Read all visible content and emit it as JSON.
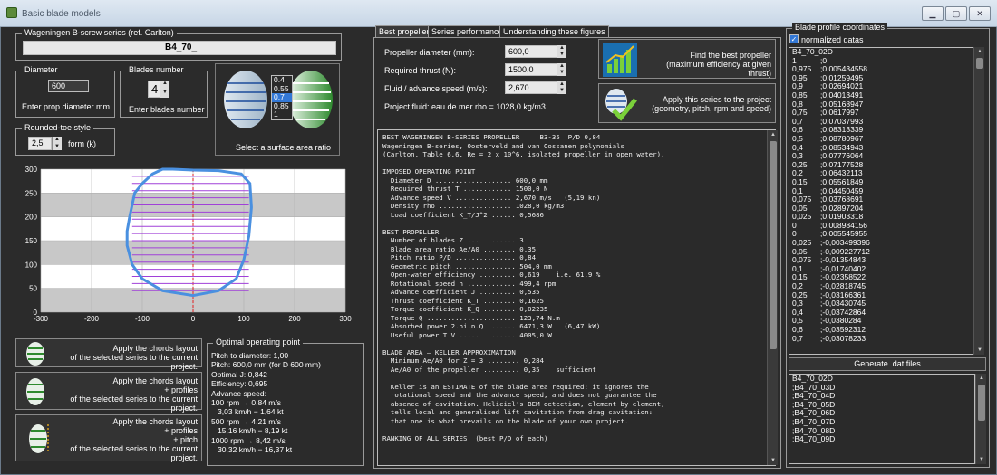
{
  "window": {
    "title": "Basic blade models",
    "controls": [
      "min",
      "max",
      "close"
    ]
  },
  "series": {
    "group_title": "Wageningen B-screw series (ref. Carlton)",
    "name": "B4_70_"
  },
  "diameter": {
    "group_title": "Diameter",
    "value": "600",
    "caption": "Enter prop diameter mm"
  },
  "blades": {
    "group_title": "Blades number",
    "value": "4",
    "caption": "Enter blades number"
  },
  "area_ratio": {
    "options": [
      "0.4",
      "0.55",
      "0.7",
      "0.85",
      "1"
    ],
    "selected": "0.7",
    "caption": "Select a surface area ratio"
  },
  "rounded_toe": {
    "group_title": "Rounded-toe style",
    "value": "2,5",
    "caption": "form (k)"
  },
  "plot": {
    "x_ticks": [
      "-300",
      "-200",
      "-100",
      "0",
      "100",
      "200",
      "300"
    ],
    "y_ticks": [
      "300",
      "250",
      "200",
      "150",
      "100",
      "50",
      "0"
    ]
  },
  "chart_data": {
    "type": "line",
    "title": "",
    "xlabel": "",
    "ylabel": "",
    "xlim": [
      -300,
      300
    ],
    "ylim": [
      0,
      300
    ],
    "grid": true,
    "series": [
      {
        "outline": true,
        "x": [
          -60,
          -80,
          -100,
          -115,
          -120,
          -125,
          -130,
          -130,
          -120,
          -100,
          -60,
          0,
          50,
          85,
          100,
          110,
          115,
          112,
          95,
          50,
          0,
          -40
        ],
        "y": [
          300,
          290,
          270,
          250,
          225,
          200,
          170,
          140,
          100,
          70,
          45,
          35,
          45,
          70,
          110,
          160,
          220,
          270,
          290,
          297,
          298,
          300
        ]
      }
    ]
  },
  "apply_buttons": [
    {
      "text": "Apply the chords layout\nof the selected series to the current project."
    },
    {
      "text": "Apply the chords layout\n+ profiles\nof the selected series to the current project."
    },
    {
      "text": "Apply the chords layout\n+ profiles\n+ pitch\nof the selected series to the current project."
    }
  ],
  "optimal": {
    "group_title": "Optimal operating point",
    "lines": [
      "Pitch to diameter: 1,00",
      "Pitch: 600,0 mm (for D 600 mm)",
      "Optimal J: 0,842",
      "Efficiency: 0,695",
      "Advance speed:",
      "100 rpm → 0,84 m/s",
      "   3,03 km/h − 1,64 kt",
      "500 rpm → 4,21 m/s",
      "   15,16 km/h − 8,19 kt",
      "1000 rpm → 8,42 m/s",
      "   30,32 km/h − 16,37 kt"
    ]
  },
  "tabs": [
    "Best propeller",
    "Series performance",
    "Understanding these figures"
  ],
  "inputs": {
    "diameter_label": "Propeller diameter (mm):",
    "diameter_value": "600,0",
    "thrust_label": "Required thrust (N):",
    "thrust_value": "1500,0",
    "speed_label": "Fluid / advance speed (m/s):",
    "speed_value": "2,670",
    "fluid_text": "Project fluid: eau de mer   rho = 1028,0 kg/m3"
  },
  "actions": {
    "find_best": "Find the best propeller\n(maximum efficiency at given thrust)",
    "apply_series": "Apply this series to the project\n(geometry, pitch, rpm and speed)"
  },
  "report_text": "BEST WAGENINGEN B-SERIES PROPELLER  —  B3-35  P/D 0,84\nWageningen B-series, Oosterveld and van Oossanen polynomials\n(Carlton, Table 6.6, Re = 2 x 10^6, isolated propeller in open water).\n\nIMPOSED OPERATING POINT\n  Diameter D ................... 600,0 mm\n  Required thrust T ............ 1500,0 N\n  Advance speed V .............. 2,670 m/s   (5,19 kn)\n  Density rho .................. 1028,0 kg/m3\n  Load coefficient K_T/J^2 ...... 0,5686\n\nBEST PROPELLER\n  Number of blades Z ............ 3\n  Blade area ratio Ae/A0 ........ 0,35\n  Pitch ratio P/D ............... 0,84\n  Geometric pitch ............... 504,0 mm\n  Open-water efficiency ......... 0,619    i.e. 61,9 %\n  Rotational speed n ............ 499,4 rpm\n  Advance coefficient J ......... 0,535\n  Thrust coefficient K_T ........ 0,1625\n  Torque coefficient K_Q ........ 0,02235\n  Torque Q ...................... 123,74 N.m\n  Absorbed power 2.pi.n.Q ....... 6471,3 W   (6,47 kW)\n  Useful power T.V .............. 4005,0 W\n\nBLADE AREA — KELLER APPROXIMATION\n  Minimum Ae/A0 for Z = 3 ........ 0,284\n  Ae/A0 of the propeller ......... 0,35    sufficient\n\n  Keller is an ESTIMATE of the blade area required: it ignores the\n  rotational speed and the advance speed, and does not guarantee the\n  absence of cavitation. Heliciel's BEM detection, element by element,\n  tells local and generalised lift cavitation from drag cavitation:\n  that one is what prevails on the blade of your own project.\n\nRANKING OF ALL SERIES  (best P/D of each)",
  "profile": {
    "group_title": "Blade profile coordinates",
    "checkbox_label": "normalized datas",
    "checked": true,
    "header": "B4_70_02D",
    "rows": [
      [
        "1",
        ";0"
      ],
      [
        "0,975",
        ";0,005434558"
      ],
      [
        "0,95",
        ";0,01259495"
      ],
      [
        "0,9",
        ";0,02694021"
      ],
      [
        "0,85",
        ";0,04013491"
      ],
      [
        "0,8",
        ";0,05168947"
      ],
      [
        "0,75",
        ";0,0617997"
      ],
      [
        "0,7",
        ";0,07037993"
      ],
      [
        "0,6",
        ";0,08313339"
      ],
      [
        "0,5",
        ";0,08780967"
      ],
      [
        "0,4",
        ";0,08534943"
      ],
      [
        "0,3",
        ";0,07776064"
      ],
      [
        "0,25",
        ";0,07177528"
      ],
      [
        "0,2",
        ";0,06432113"
      ],
      [
        "0,15",
        ";0,05561849"
      ],
      [
        "0,1",
        ";0,04450459"
      ],
      [
        "0,075",
        ";0,03768691"
      ],
      [
        "0,05",
        ";0,02897204"
      ],
      [
        "0,025",
        ";0,01903318"
      ],
      [
        "0",
        ";0,008984156"
      ],
      [
        "0",
        ";0,005545955"
      ],
      [
        "0,025",
        ";-0,003499396"
      ],
      [
        "0,05",
        ";-0,009227712"
      ],
      [
        "0,075",
        ";-0,01354843"
      ],
      [
        "0,1",
        ";-0,01740402"
      ],
      [
        "0,15",
        ";-0,02358522"
      ],
      [
        "0,2",
        ";-0,02818745"
      ],
      [
        "0,25",
        ";-0,03166361"
      ],
      [
        "0,3",
        ";-0,03430745"
      ],
      [
        "0,4",
        ";-0,03742864"
      ],
      [
        "0,5",
        ";-0,0380284"
      ],
      [
        "0,6",
        ";-0,03592312"
      ],
      [
        "0,7",
        ";-0,03078233"
      ]
    ],
    "generate_button": "Generate .dat files",
    "files": [
      "B4_70_02D",
      ";B4_70_03D",
      ";B4_70_04D",
      ";B4_70_05D",
      ";B4_70_06D",
      ";B4_70_07D",
      ";B4_70_08D",
      ";B4_70_09D"
    ]
  }
}
